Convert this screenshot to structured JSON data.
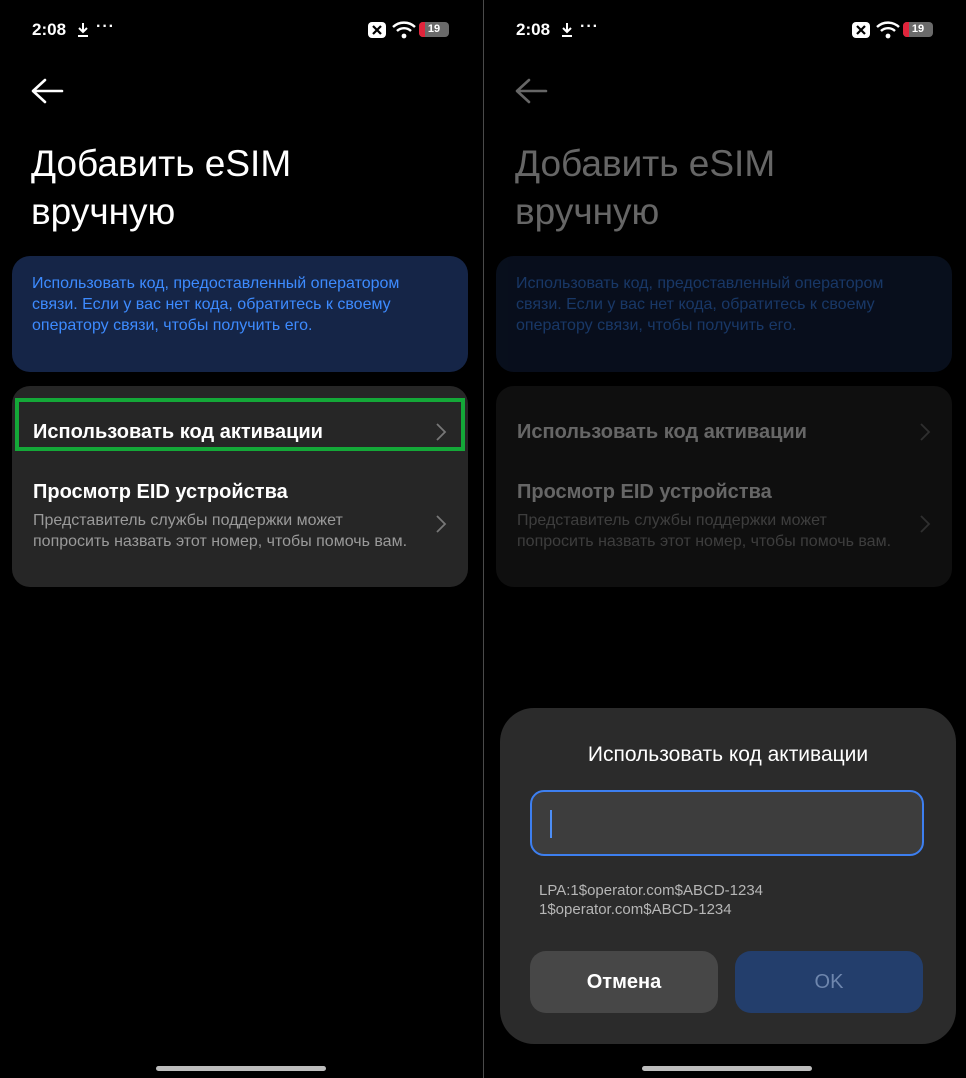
{
  "status_bar": {
    "time": "2:08",
    "dots": "···",
    "battery_level": "19",
    "battery_color": "#e0243b"
  },
  "page": {
    "title_line1": "Добавить eSIM",
    "title_line2": "вручную",
    "info_text": "Использовать код, предоставленный оператором связи. Если у вас нет кода, обратитесь к своему оператору связи, чтобы получить его.",
    "items": [
      {
        "label": "Использовать код активации"
      },
      {
        "label": "Просмотр EID устройства",
        "description": "Представитель службы поддержки может попросить назвать этот номер, чтобы помочь вам."
      }
    ]
  },
  "dialog": {
    "title": "Использовать код активации",
    "input_value": "",
    "hint_line1": "LPA:1$operator.com$ABCD-1234",
    "hint_line2": "1$operator.com$ABCD-1234",
    "cancel_label": "Отмена",
    "ok_label": "OK"
  },
  "colors": {
    "accent": "#3d8bff",
    "highlight": "#14a838",
    "info_bg": "#152547",
    "card_bg": "#262626"
  }
}
